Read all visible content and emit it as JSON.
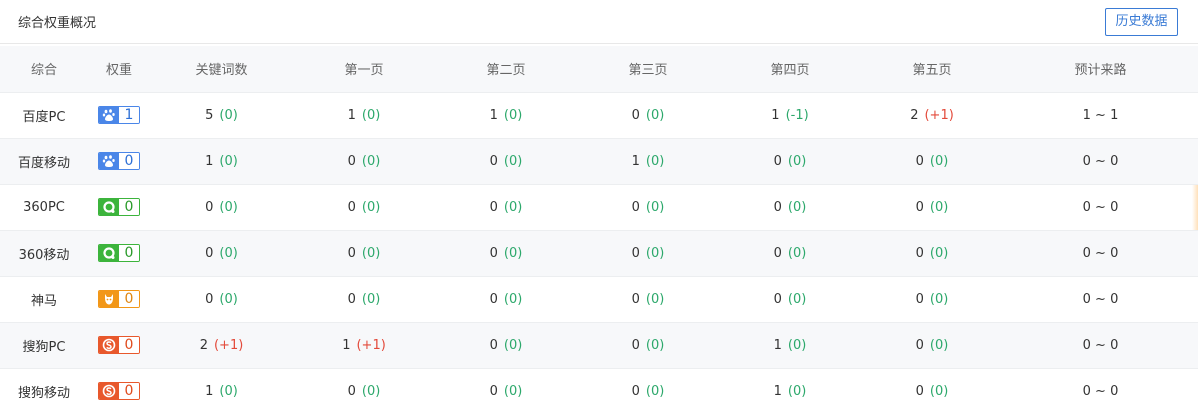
{
  "header": {
    "title": "综合权重概况",
    "history_label": "历史数据"
  },
  "columns": [
    "综合",
    "权重",
    "关键词数",
    "第一页",
    "第二页",
    "第三页",
    "第四页",
    "第五页",
    "预计来路"
  ],
  "rows": [
    {
      "engine": "百度PC",
      "icon": "baidu-paw-icon",
      "brand": "baidu",
      "weight": "1",
      "cells": [
        [
          "5",
          "(0)",
          "green"
        ],
        [
          "1",
          "(0)",
          "green"
        ],
        [
          "1",
          "(0)",
          "green"
        ],
        [
          "0",
          "(0)",
          "green"
        ],
        [
          "1",
          "(-1)",
          "green"
        ],
        [
          "2",
          "(+1)",
          "red"
        ]
      ],
      "traffic": "1 ~ 1"
    },
    {
      "engine": "百度移动",
      "icon": "baidu-paw-icon",
      "brand": "baidu",
      "weight": "0",
      "cells": [
        [
          "1",
          "(0)",
          "green"
        ],
        [
          "0",
          "(0)",
          "green"
        ],
        [
          "0",
          "(0)",
          "green"
        ],
        [
          "1",
          "(0)",
          "green"
        ],
        [
          "0",
          "(0)",
          "green"
        ],
        [
          "0",
          "(0)",
          "green"
        ]
      ],
      "traffic": "0 ~ 0"
    },
    {
      "engine": "360PC",
      "icon": "360-icon",
      "brand": "360",
      "weight": "0",
      "cells": [
        [
          "0",
          "(0)",
          "green"
        ],
        [
          "0",
          "(0)",
          "green"
        ],
        [
          "0",
          "(0)",
          "green"
        ],
        [
          "0",
          "(0)",
          "green"
        ],
        [
          "0",
          "(0)",
          "green"
        ],
        [
          "0",
          "(0)",
          "green"
        ]
      ],
      "traffic": "0 ~ 0"
    },
    {
      "engine": "360移动",
      "icon": "360-icon",
      "brand": "360",
      "weight": "0",
      "cells": [
        [
          "0",
          "(0)",
          "green"
        ],
        [
          "0",
          "(0)",
          "green"
        ],
        [
          "0",
          "(0)",
          "green"
        ],
        [
          "0",
          "(0)",
          "green"
        ],
        [
          "0",
          "(0)",
          "green"
        ],
        [
          "0",
          "(0)",
          "green"
        ]
      ],
      "traffic": "0 ~ 0"
    },
    {
      "engine": "神马",
      "icon": "shenma-icon",
      "brand": "sm",
      "weight": "0",
      "cells": [
        [
          "0",
          "(0)",
          "green"
        ],
        [
          "0",
          "(0)",
          "green"
        ],
        [
          "0",
          "(0)",
          "green"
        ],
        [
          "0",
          "(0)",
          "green"
        ],
        [
          "0",
          "(0)",
          "green"
        ],
        [
          "0",
          "(0)",
          "green"
        ]
      ],
      "traffic": "0 ~ 0"
    },
    {
      "engine": "搜狗PC",
      "icon": "sogou-icon",
      "brand": "sogou",
      "weight": "0",
      "cells": [
        [
          "2",
          "(+1)",
          "red"
        ],
        [
          "1",
          "(+1)",
          "red"
        ],
        [
          "0",
          "(0)",
          "green"
        ],
        [
          "0",
          "(0)",
          "green"
        ],
        [
          "1",
          "(0)",
          "green"
        ],
        [
          "0",
          "(0)",
          "green"
        ]
      ],
      "traffic": "0 ~ 0"
    },
    {
      "engine": "搜狗移动",
      "icon": "sogou-icon",
      "brand": "sogou",
      "weight": "0",
      "cells": [
        [
          "1",
          "(0)",
          "green"
        ],
        [
          "0",
          "(0)",
          "green"
        ],
        [
          "0",
          "(0)",
          "green"
        ],
        [
          "0",
          "(0)",
          "green"
        ],
        [
          "1",
          "(0)",
          "green"
        ],
        [
          "0",
          "(0)",
          "green"
        ]
      ],
      "traffic": "0 ~ 0"
    }
  ],
  "colors": {
    "accent": "#3a7bd5",
    "up": "#e34a3b",
    "neutral": "#2ca86b",
    "baidu": "#4a86e8",
    "qihoo": "#3cb43c",
    "shenma": "#f29718",
    "sogou": "#e8582c"
  }
}
